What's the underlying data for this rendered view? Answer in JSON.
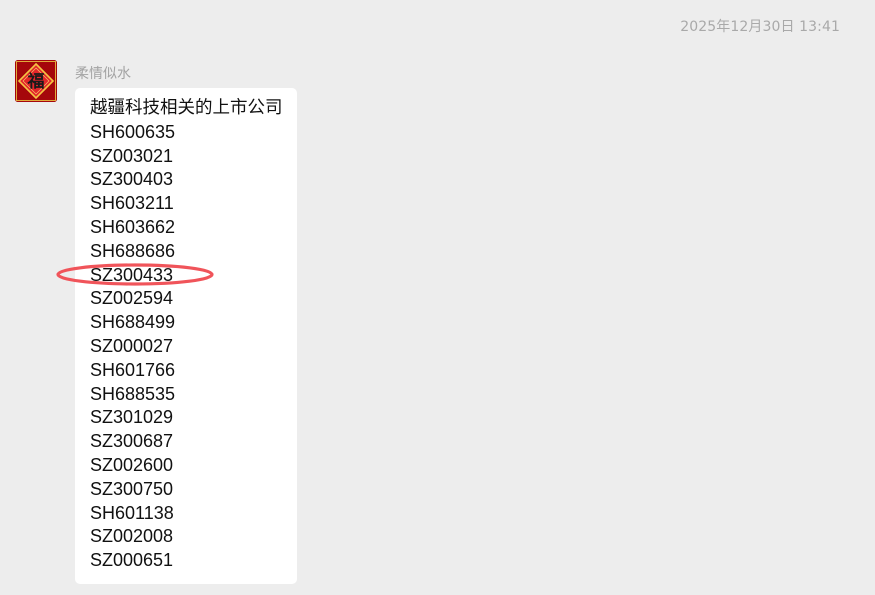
{
  "chat": {
    "timestamp": "2025年12月30日 13:41",
    "sender": {
      "name": "柔情似水",
      "avatar_icon": "fu-character-avatar",
      "avatar_char": "福"
    },
    "message": {
      "title": "越疆科技相关的上市公司",
      "codes": [
        "SH600635",
        "SZ003021",
        "SZ300403",
        "SH603211",
        "SH603662",
        "SH688686",
        "SZ300433",
        "SZ002594",
        "SH688499",
        "SZ000027",
        "SH601766",
        "SH688535",
        "SZ301029",
        "SZ300687",
        "SZ002600",
        "SZ300750",
        "SH601138",
        "SZ002008",
        "SZ000651"
      ],
      "highlighted_code": "SZ300433"
    },
    "colors": {
      "background": "#ededed",
      "bubble": "#ffffff",
      "text": "#111111",
      "meta_text": "#a9a9a9",
      "highlight_ring": "#f0545a",
      "avatar_red": "#a5070b",
      "avatar_gold": "#f5c543"
    }
  }
}
